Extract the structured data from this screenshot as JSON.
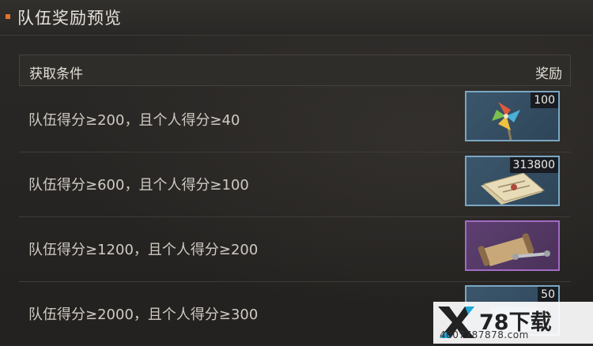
{
  "header": {
    "title": "队伍奖励预览",
    "accent_color": "#e0742a"
  },
  "table": {
    "col_condition": "获取条件",
    "col_reward": "奖励",
    "rows": [
      {
        "condition": "队伍得分≥200，且个人得分≥40",
        "reward_count": "100",
        "reward_icon": "pinwheel-icon",
        "rarity": "blue"
      },
      {
        "condition": "队伍得分≥600，且个人得分≥100",
        "reward_count": "313800",
        "reward_icon": "certificate-icon",
        "rarity": "blue"
      },
      {
        "condition": "队伍得分≥1200，且个人得分≥200",
        "reward_count": "",
        "reward_icon": "scroll-blueprint-icon",
        "rarity": "purple"
      },
      {
        "condition": "队伍得分≥2000，且个人得分≥300",
        "reward_count": "50",
        "reward_icon": "item-icon",
        "rarity": "blue"
      }
    ]
  },
  "watermark": {
    "brand": "78下载",
    "url": "4007787878.com"
  }
}
